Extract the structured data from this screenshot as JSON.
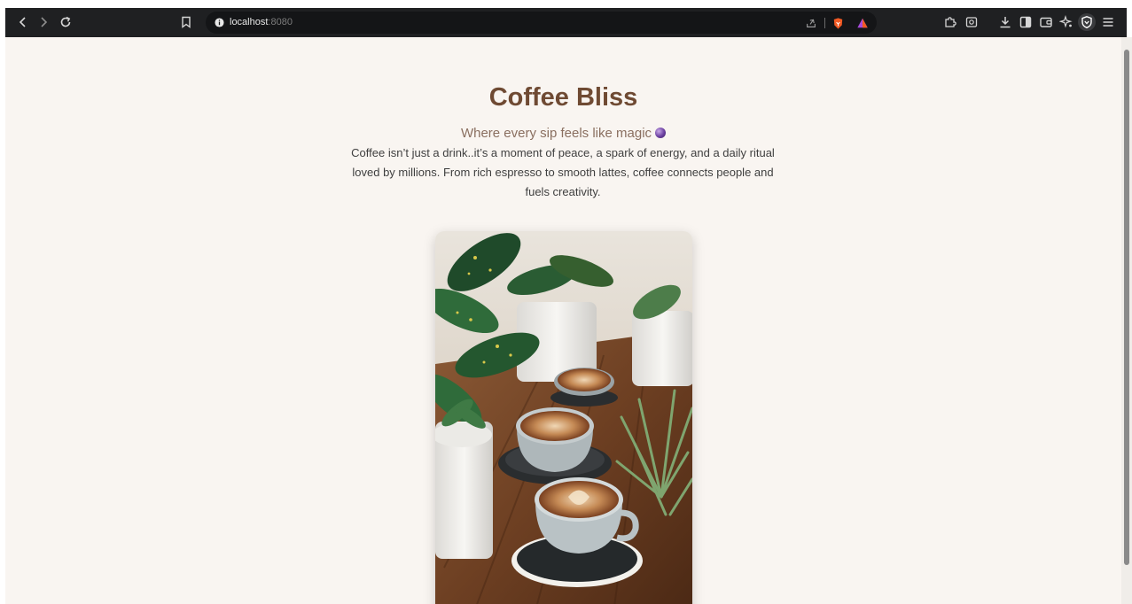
{
  "browser": {
    "url_host": "localhost",
    "url_port": ":8080",
    "icons": {
      "back": "chevron-left-icon",
      "forward": "chevron-right-icon",
      "reload": "reload-icon",
      "bookmark": "bookmark-icon",
      "site_info": "info-icon",
      "share": "share-icon",
      "brave_shields": "brave-lion-icon",
      "rewards": "rewards-triangle-icon",
      "extensions": "puzzle-icon",
      "screenshot": "screenshot-icon",
      "downloads": "download-icon",
      "sidebar": "sidebar-icon",
      "wallet": "wallet-icon",
      "leo": "sparkle-icon",
      "vpn": "shield-icon",
      "menu": "hamburger-icon"
    },
    "colors": {
      "toolbar_bg": "#1f2022",
      "brave_orange": "#f15a24",
      "rewards_purple": "#a74bdb"
    }
  },
  "page": {
    "title": "Coffee Bliss",
    "tagline": "Where every sip feels like magic",
    "description": "Coffee isn’t just a drink..it’s a moment of peace, a spark of energy, and a daily ritual loved by millions. From rich espresso to smooth lattes, coffee connects people and fuels creativity.",
    "colors": {
      "background": "#f9f5f1",
      "title": "#6f4a33",
      "tagline": "#8a6f60",
      "text": "#3f3f3f"
    }
  }
}
